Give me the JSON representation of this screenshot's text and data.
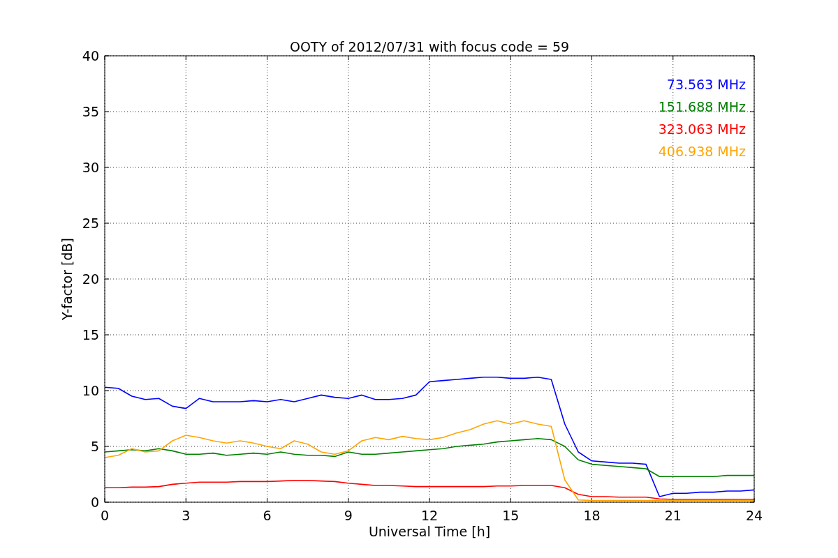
{
  "chart_data": {
    "type": "line",
    "title": "OOTY of 2012/07/31 with focus code = 59",
    "xlabel": "Universal Time [h]",
    "ylabel": "Y-factor [dB]",
    "x": [
      0,
      0.5,
      1,
      1.5,
      2,
      2.5,
      3,
      3.5,
      4,
      4.5,
      5,
      5.5,
      6,
      6.5,
      7,
      7.5,
      8,
      8.5,
      9,
      9.5,
      10,
      10.5,
      11,
      11.5,
      12,
      12.5,
      13,
      13.5,
      14,
      14.5,
      15,
      15.5,
      16,
      16.5,
      17,
      17.5,
      18,
      18.5,
      19,
      19.5,
      20,
      20.5,
      21,
      21.5,
      22,
      22.5,
      23,
      23.5,
      24
    ],
    "series": [
      {
        "name": "73.563 MHz",
        "color": "#0000ff",
        "values": [
          10.3,
          10.2,
          9.5,
          9.2,
          9.3,
          8.6,
          8.4,
          9.3,
          9.0,
          9.0,
          9.0,
          9.1,
          9.0,
          9.2,
          9.0,
          9.3,
          9.6,
          9.4,
          9.3,
          9.6,
          9.2,
          9.2,
          9.3,
          9.6,
          10.8,
          10.9,
          11.0,
          11.1,
          11.2,
          11.2,
          11.1,
          11.1,
          11.2,
          11.0,
          7.0,
          4.5,
          3.7,
          3.6,
          3.5,
          3.5,
          3.4,
          0.5,
          0.8,
          0.8,
          0.9,
          0.9,
          1.0,
          1.0,
          1.1
        ]
      },
      {
        "name": "151.688 MHz",
        "color": "#008000",
        "values": [
          4.5,
          4.6,
          4.7,
          4.6,
          4.8,
          4.6,
          4.3,
          4.3,
          4.4,
          4.2,
          4.3,
          4.4,
          4.3,
          4.5,
          4.3,
          4.2,
          4.2,
          4.1,
          4.5,
          4.3,
          4.3,
          4.4,
          4.5,
          4.6,
          4.7,
          4.8,
          5.0,
          5.1,
          5.2,
          5.4,
          5.5,
          5.6,
          5.7,
          5.6,
          5.0,
          3.8,
          3.4,
          3.3,
          3.2,
          3.1,
          3.0,
          2.3,
          2.3,
          2.3,
          2.3,
          2.3,
          2.4,
          2.4,
          2.4
        ]
      },
      {
        "name": "323.063 MHz",
        "color": "#ff0000",
        "values": [
          1.3,
          1.3,
          1.35,
          1.35,
          1.4,
          1.6,
          1.7,
          1.8,
          1.8,
          1.8,
          1.85,
          1.85,
          1.85,
          1.9,
          1.95,
          1.95,
          1.9,
          1.85,
          1.7,
          1.6,
          1.5,
          1.5,
          1.45,
          1.4,
          1.4,
          1.4,
          1.4,
          1.4,
          1.4,
          1.45,
          1.45,
          1.5,
          1.5,
          1.5,
          1.3,
          0.7,
          0.5,
          0.5,
          0.45,
          0.45,
          0.45,
          0.3,
          0.25,
          0.25,
          0.25,
          0.25,
          0.25,
          0.25,
          0.25
        ]
      },
      {
        "name": "406.938 MHz",
        "color": "#ffa500",
        "values": [
          4.0,
          4.2,
          4.8,
          4.5,
          4.6,
          5.5,
          6.0,
          5.8,
          5.5,
          5.3,
          5.5,
          5.3,
          5.0,
          4.8,
          5.5,
          5.2,
          4.5,
          4.3,
          4.6,
          5.5,
          5.8,
          5.6,
          5.9,
          5.7,
          5.6,
          5.8,
          6.2,
          6.5,
          7.0,
          7.3,
          7.0,
          7.3,
          7.0,
          6.8,
          2.0,
          0.2,
          0.15,
          0.15,
          0.15,
          0.15,
          0.15,
          0.15,
          0.15,
          0.15,
          0.15,
          0.15,
          0.15,
          0.15,
          0.15
        ]
      }
    ],
    "xlim": [
      0,
      24
    ],
    "ylim": [
      0,
      40
    ],
    "xticks": [
      0,
      3,
      6,
      9,
      12,
      15,
      18,
      21,
      24
    ],
    "yticks": [
      0,
      5,
      10,
      15,
      20,
      25,
      30,
      35,
      40
    ],
    "grid": true
  }
}
